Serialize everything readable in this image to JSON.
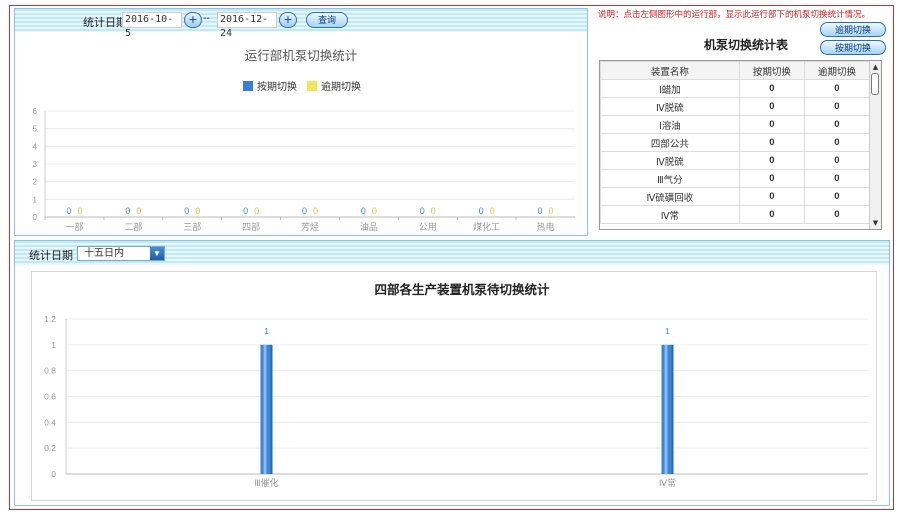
{
  "top_panel": {
    "date_label": "统计日期",
    "start_date": "2016-10-5",
    "range_sep": "--",
    "end_date": "2016-12-24",
    "plus_label": "+",
    "query_label": "查询"
  },
  "chart1": {
    "title": "运行部机泵切换统计",
    "legend": [
      "按期切换",
      "逾期切换"
    ],
    "y_ticks": [
      "6",
      "5",
      "4",
      "3",
      "2",
      "1",
      "0"
    ],
    "categories": [
      "一部",
      "二部",
      "三部",
      "四部",
      "芳烃",
      "油品",
      "公用",
      "煤化工",
      "热电"
    ],
    "colors": {
      "on_time": "#3a7fd4",
      "overdue": "#f2e55a",
      "value_label_a": "#3a8fd9",
      "value_label_b": "#d9c640"
    }
  },
  "right_panel": {
    "note": "说明：点击左侧图形中的运行部，显示此运行部下的机泵切换统计情况。",
    "btn_overdue": "逾期切换",
    "btn_ontime": "按期切换",
    "title": "机泵切换统计表",
    "columns": [
      "装置名称",
      "按期切换",
      "逾期切换"
    ],
    "rows": [
      [
        "Ⅰ蜡加",
        "0",
        "0"
      ],
      [
        "Ⅳ脱硫",
        "0",
        "0"
      ],
      [
        "Ⅰ溶油",
        "0",
        "0"
      ],
      [
        "四部公共",
        "0",
        "0"
      ],
      [
        "Ⅳ脱硫",
        "0",
        "0"
      ],
      [
        "Ⅲ气分",
        "0",
        "0"
      ],
      [
        "Ⅳ硫磺回收",
        "0",
        "0"
      ],
      [
        "Ⅳ常",
        "0",
        "0"
      ]
    ],
    "scroll_up": "▲",
    "scroll_down": "▼"
  },
  "bottom_panel": {
    "date_label": "统计日期",
    "select_value": "十五日内",
    "select_arrow": "▼"
  },
  "chart_data": [
    {
      "type": "bar",
      "title": "运行部机泵切换统计",
      "categories": [
        "一部",
        "二部",
        "三部",
        "四部",
        "芳烃",
        "油品",
        "公用",
        "煤化工",
        "热电"
      ],
      "series": [
        {
          "name": "按期切换",
          "values": [
            0,
            0,
            0,
            0,
            0,
            0,
            0,
            0,
            0
          ]
        },
        {
          "name": "逾期切换",
          "values": [
            0,
            0,
            0,
            0,
            0,
            0,
            0,
            0,
            0
          ]
        }
      ],
      "ylim": [
        0,
        6
      ],
      "legend": "top-center",
      "grid": true
    },
    {
      "type": "bar",
      "title": "四部各生产装置机泵待切换统计",
      "categories": [
        "Ⅲ催化",
        "Ⅳ常"
      ],
      "values": [
        1,
        1
      ],
      "y_ticks": [
        "1.2",
        "1",
        "0.8",
        "0.6",
        "0.4",
        "0.2",
        "0"
      ],
      "ylim": [
        0,
        1.2
      ],
      "grid": true,
      "bar_color": "#3b84d6",
      "label_color": "#3a8fd9"
    }
  ]
}
